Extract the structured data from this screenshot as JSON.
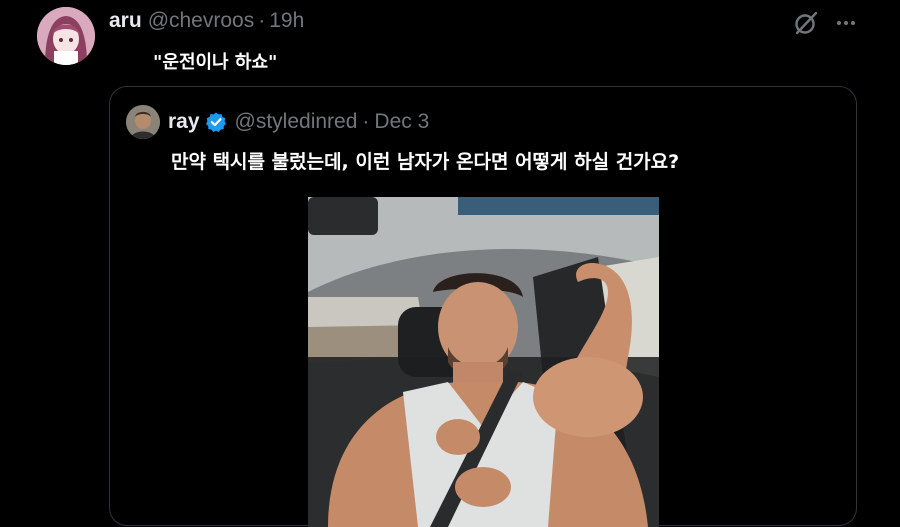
{
  "tweet": {
    "display_name": "aru",
    "handle": "@chevroos",
    "separator": "·",
    "time": "19h",
    "text": "\"운전이나 하쇼\"",
    "avatar_icon": "anime-girl-avatar"
  },
  "toolbar": {
    "grok_icon": "grok-icon",
    "more_icon": "more-icon"
  },
  "quote": {
    "display_name": "ray",
    "verified_icon": "verified-badge-icon",
    "handle": "@styledinred",
    "separator": "·",
    "date": "Dec 3",
    "text": "만약 택시를 불렀는데, 이런 남자가 온다면 어떻게 하실 건가요?",
    "media_description_icon": "photo-thumbnail"
  },
  "colors": {
    "background": "#000000",
    "primary_text": "#e7e9ea",
    "secondary_text": "#71767b",
    "border": "#2f3336",
    "verified_blue": "#1d9bf0"
  }
}
